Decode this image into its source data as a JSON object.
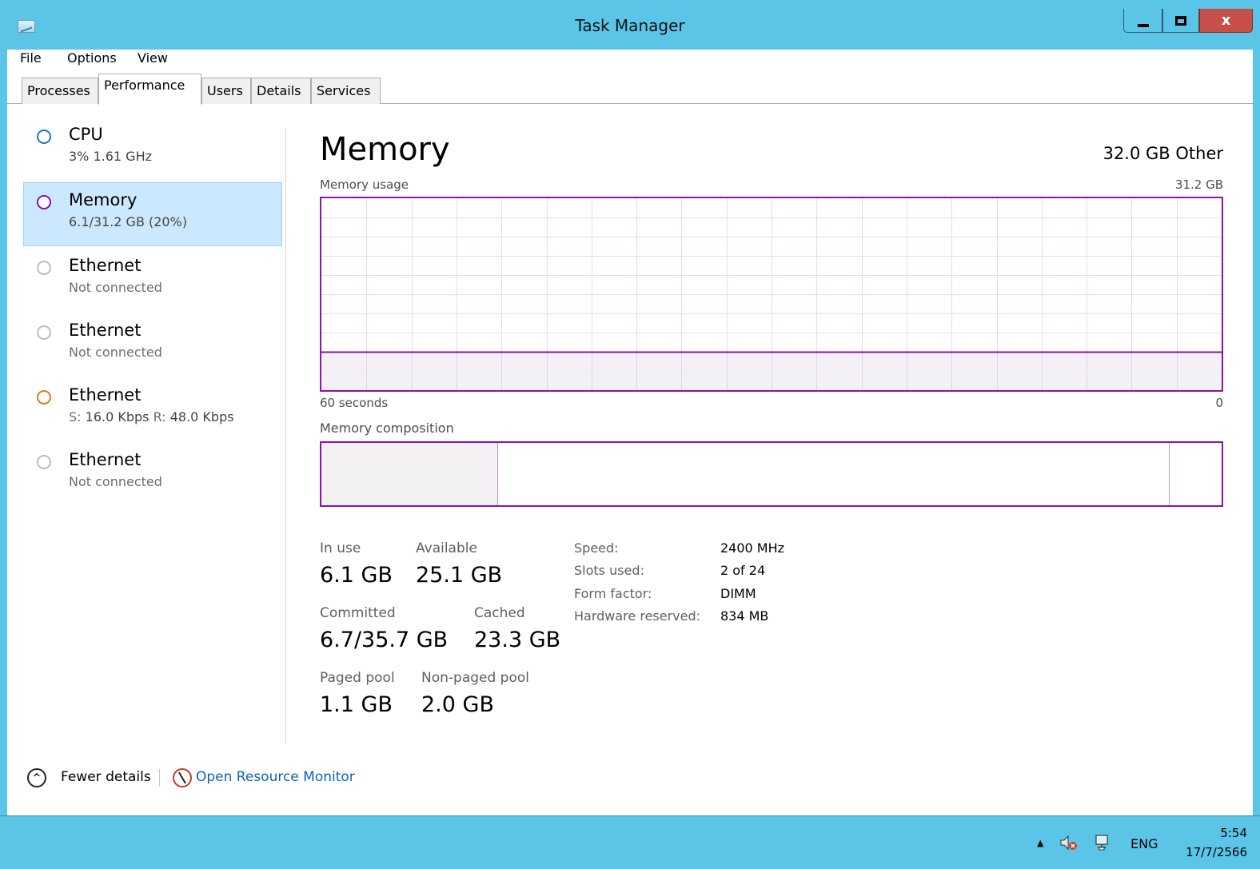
{
  "window": {
    "title": "Task Manager",
    "close_label": "x"
  },
  "menu": [
    "File",
    "Options",
    "View"
  ],
  "tabs": [
    "Processes",
    "Performance",
    "Users",
    "Details",
    "Services"
  ],
  "sidebar": [
    {
      "name": "CPU",
      "detail": "3% 1.61 GHz",
      "ring_color": "#1979ca",
      "selected": false
    },
    {
      "name": "Memory",
      "detail": "6.1/31.2 GB (20%)",
      "ring_color": "#8b12ae",
      "selected": true
    },
    {
      "name": "Ethernet",
      "detail": "Not connected",
      "ring_color": "#bdbdbd",
      "selected": false
    },
    {
      "name": "Ethernet",
      "detail": "Not connected",
      "ring_color": "#bdbdbd",
      "selected": false
    },
    {
      "name": "Ethernet",
      "detail_send_label": "S:",
      "detail_send": "16.0 Kbps",
      "detail_recv_label": "R:",
      "detail_recv": "48.0 Kbps",
      "ring_color": "#d77b27",
      "selected": false
    },
    {
      "name": "Ethernet",
      "detail": "Not connected",
      "ring_color": "#bdbdbd",
      "selected": false
    }
  ],
  "main": {
    "title": "Memory",
    "total": "32.0 GB Other",
    "usage_caption": "Memory usage",
    "usage_max": "31.2 GB",
    "usage_x_left": "60 seconds",
    "usage_x_right": "0",
    "usage_fraction": 0.2,
    "composition_caption": "Memory composition",
    "composition": {
      "in_use_fraction": 0.196,
      "standby_fraction": 0.746,
      "free_fraction": 0.058
    },
    "stats": {
      "in_use_label": "In use",
      "in_use_value": "6.1 GB",
      "available_label": "Available",
      "available_value": "25.1 GB",
      "committed_label": "Committed",
      "committed_value": "6.7/35.7 GB",
      "cached_label": "Cached",
      "cached_value": "23.3 GB",
      "paged_label": "Paged pool",
      "paged_value": "1.1 GB",
      "nonpaged_label": "Non-paged pool",
      "nonpaged_value": "2.0 GB"
    },
    "specs": {
      "speed_label": "Speed:",
      "speed_value": "2400 MHz",
      "slots_label": "Slots used:",
      "slots_value": "2 of 24",
      "form_label": "Form factor:",
      "form_value": "DIMM",
      "reserved_label": "Hardware reserved:",
      "reserved_value": "834 MB"
    }
  },
  "footer": {
    "fewer_details": "Fewer details",
    "open_resource_monitor": "Open Resource Monitor"
  },
  "taskbar": {
    "language": "ENG",
    "time": "5:54",
    "date": "17/7/2566"
  },
  "colors": {
    "memory_accent": "#8b12ae",
    "link": "#0d63b3",
    "titlebar": "#5bc5e8",
    "close_button": "#c7504a"
  }
}
